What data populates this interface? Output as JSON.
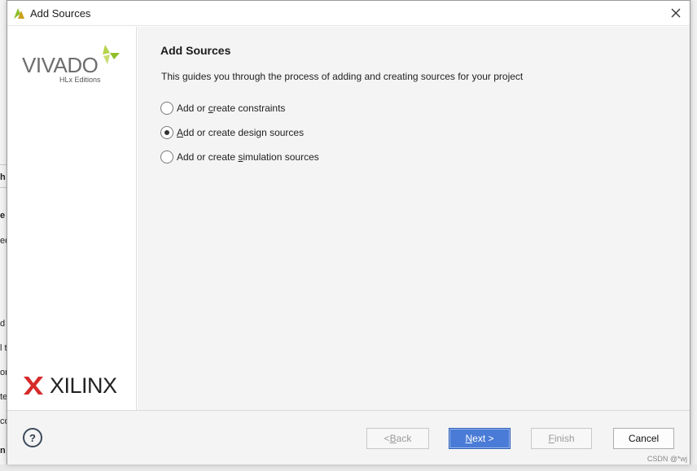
{
  "window": {
    "title": "Add Sources"
  },
  "brand": {
    "product": "VIVADO",
    "edition": "HLx Editions",
    "vendor": "XILINX"
  },
  "page": {
    "heading": "Add Sources",
    "description": "This guides you through the process of adding and creating sources for your project"
  },
  "options": [
    {
      "pre": "Add or ",
      "key": "c",
      "post": "reate constraints",
      "checked": false
    },
    {
      "pre": "",
      "key": "A",
      "post": "dd or create design sources",
      "checked": true
    },
    {
      "pre": "Add or create ",
      "key": "s",
      "post": "imulation sources",
      "checked": false
    }
  ],
  "footer": {
    "help": "?",
    "back": {
      "pre": "< ",
      "key": "B",
      "post": "ack"
    },
    "next": {
      "pre": "",
      "key": "N",
      "post": "ext >"
    },
    "finish": {
      "pre": "",
      "key": "F",
      "post": "inish"
    },
    "cancel": "Cancel"
  },
  "background_fragments": [
    "h",
    "e",
    "ec",
    "d",
    "l t",
    "on",
    "te",
    "co",
    "n"
  ],
  "watermark": "CSDN @*wj",
  "colors": {
    "primary_button": "#4a7bd6",
    "vivado_green": "#8fbf2a",
    "xilinx_red": "#d62b2b"
  }
}
